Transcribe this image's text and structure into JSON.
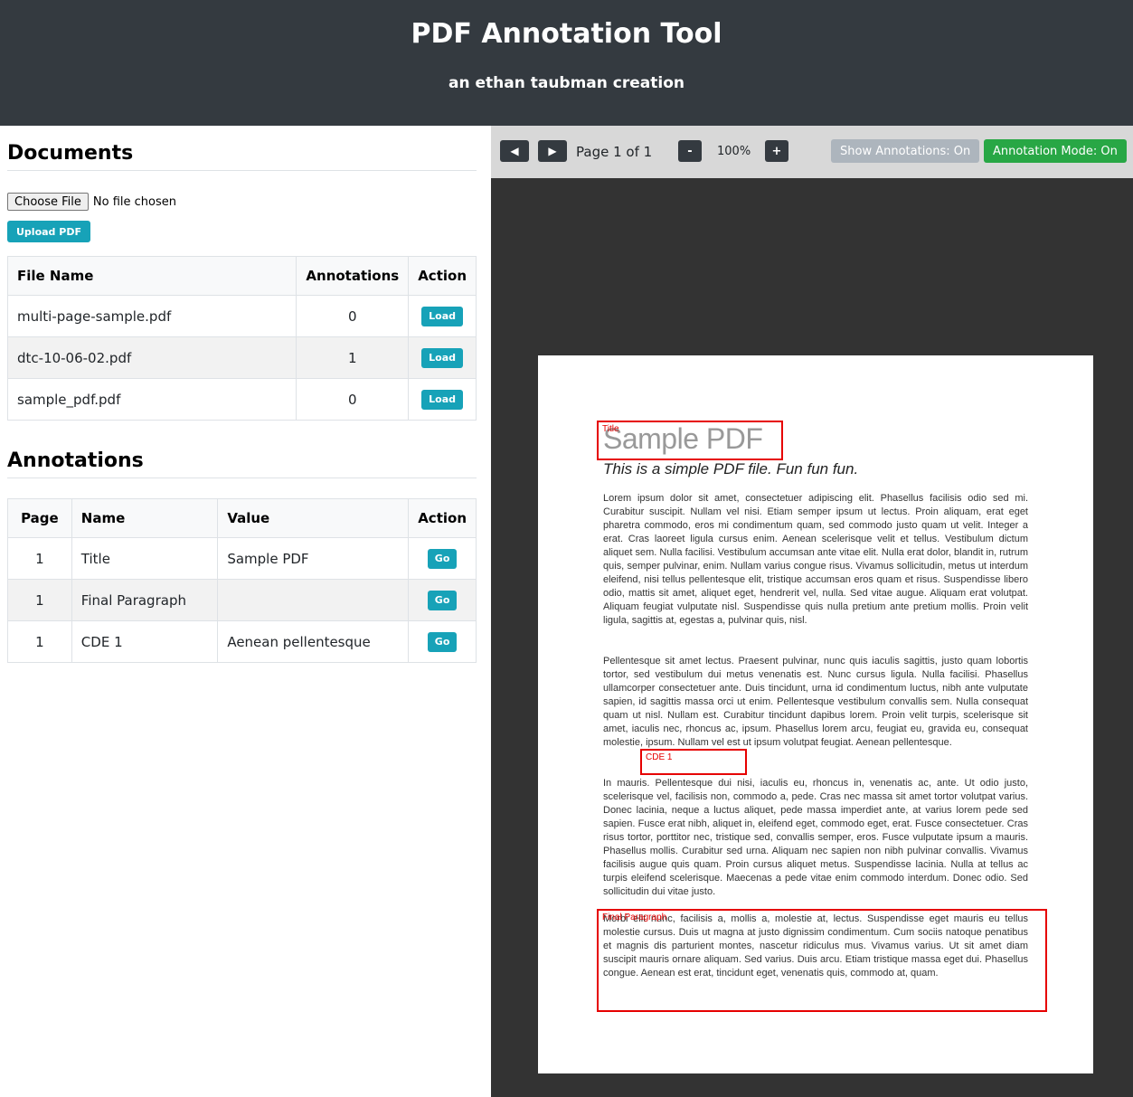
{
  "header": {
    "title": "PDF Annotation Tool",
    "subtitle": "an ethan taubman creation"
  },
  "documents": {
    "section_title": "Documents",
    "choose_file_label": "Choose File",
    "no_file_text": "No file chosen",
    "upload_label": "Upload PDF",
    "columns": [
      "File Name",
      "Annotations",
      "Action"
    ],
    "rows": [
      {
        "file_name": "multi-page-sample.pdf",
        "annotations": "0",
        "action": "Load"
      },
      {
        "file_name": "dtc-10-06-02.pdf",
        "annotations": "1",
        "action": "Load"
      },
      {
        "file_name": "sample_pdf.pdf",
        "annotations": "0",
        "action": "Load"
      }
    ]
  },
  "annotations": {
    "section_title": "Annotations",
    "columns": [
      "Page",
      "Name",
      "Value",
      "Action"
    ],
    "rows": [
      {
        "page": "1",
        "name": "Title",
        "value": "Sample PDF",
        "action": "Go"
      },
      {
        "page": "1",
        "name": "Final Paragraph",
        "value": "",
        "action": "Go"
      },
      {
        "page": "1",
        "name": "CDE 1",
        "value": "Aenean pellentesque",
        "action": "Go"
      }
    ]
  },
  "toolbar": {
    "prev_icon": "triangle-left-icon",
    "next_icon": "triangle-right-icon",
    "page_label": "Page 1 of 1",
    "zoom_out_label": "-",
    "zoom_level": "100%",
    "zoom_in_label": "+",
    "show_annotations_label": "Show Annotations: On",
    "annotation_mode_label": "Annotation Mode: On",
    "show_annotations_color": "#adb5bd",
    "annotation_mode_color": "#28a745"
  },
  "pdf": {
    "title": "Sample PDF",
    "subtitle": "This is a simple PDF file. Fun fun fun.",
    "paragraphs": [
      "Lorem ipsum dolor sit amet, consectetuer adipiscing elit. Phasellus facilisis odio sed mi. Curabitur suscipit. Nullam vel nisi. Etiam semper ipsum ut lectus. Proin aliquam, erat eget pharetra commodo, eros mi condimentum quam, sed commodo justo quam ut velit. Integer a erat. Cras laoreet ligula cursus enim. Aenean scelerisque velit et tellus. Vestibulum dictum aliquet sem. Nulla facilisi. Vestibulum accumsan ante vitae elit. Nulla erat dolor, blandit in, rutrum quis, semper pulvinar, enim. Nullam varius congue risus. Vivamus sollicitudin, metus ut interdum eleifend, nisi tellus pellentesque elit, tristique accumsan eros quam et risus. Suspendisse libero odio, mattis sit amet, aliquet eget, hendrerit vel, nulla. Sed vitae augue. Aliquam erat volutpat. Aliquam feugiat vulputate nisl. Suspendisse quis nulla pretium ante pretium mollis. Proin velit ligula, sagittis at, egestas a, pulvinar quis, nisl.",
      "Pellentesque sit amet lectus. Praesent pulvinar, nunc quis iaculis sagittis, justo quam lobortis tortor, sed vestibulum dui metus venenatis est. Nunc cursus ligula. Nulla facilisi. Phasellus ullamcorper consectetuer ante. Duis tincidunt, urna id condimentum luctus, nibh ante vulputate sapien, id sagittis massa orci ut enim. Pellentesque vestibulum convallis sem. Nulla consequat quam ut nisl. Nullam est. Curabitur tincidunt dapibus lorem. Proin velit turpis, scelerisque sit amet, iaculis nec, rhoncus ac, ipsum. Phasellus lorem arcu, feugiat eu, gravida eu, consequat molestie, ipsum. Nullam vel est ut ipsum volutpat feugiat. Aenean pellentesque.",
      "In mauris. Pellentesque dui nisi, iaculis eu, rhoncus in, venenatis ac, ante. Ut odio justo, scelerisque vel, facilisis non, commodo a, pede. Cras nec massa sit amet tortor volutpat varius. Donec lacinia, neque a luctus aliquet, pede massa imperdiet ante, at varius lorem pede sed sapien. Fusce erat nibh, aliquet in, eleifend eget, commodo eget, erat. Fusce consectetuer. Cras risus tortor, porttitor nec, tristique sed, convallis semper, eros. Fusce vulputate ipsum a mauris. Phasellus mollis. Curabitur sed urna. Aliquam nec sapien non nibh pulvinar convallis. Vivamus facilisis augue quis quam. Proin cursus aliquet metus. Suspendisse lacinia. Nulla at tellus ac turpis eleifend scelerisque. Maecenas a pede vitae enim commodo interdum. Donec odio. Sed sollicitudin dui vitae justo.",
      "Morbi elit nunc, facilisis a, mollis a, molestie at, lectus. Suspendisse eget mauris eu tellus molestie cursus. Duis ut magna at justo dignissim condimentum. Cum sociis natoque penatibus et magnis dis parturient montes, nascetur ridiculus mus. Vivamus varius. Ut sit amet diam suscipit mauris ornare aliquam. Sed varius. Duis arcu. Etiam tristique massa eget dui. Phasellus congue. Aenean est erat, tincidunt eget, venenatis quis, commodo at, quam."
    ],
    "annotation_labels": {
      "title": "Title",
      "cde": "CDE 1",
      "final_paragraph": "Final Paragraph"
    },
    "annotation_color": "#e60000"
  }
}
